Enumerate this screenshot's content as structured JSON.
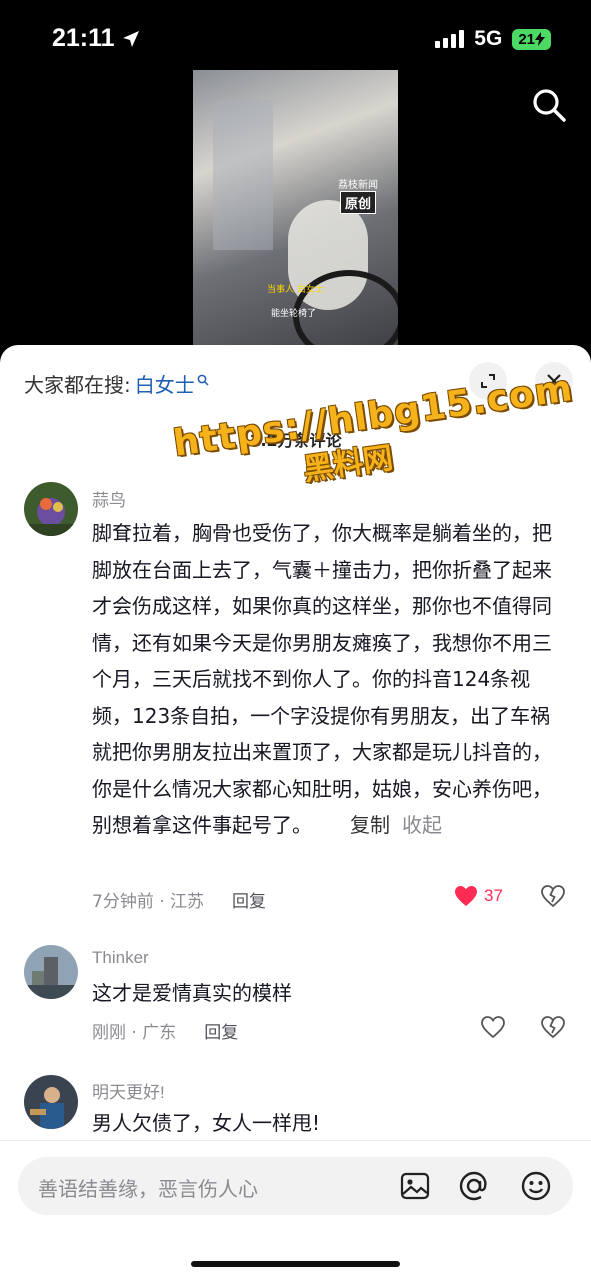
{
  "status": {
    "time": "21:11",
    "network": "5G",
    "battery": "21"
  },
  "video": {
    "watermark_top": "荔枝新闻",
    "watermark_badge": "原创",
    "caption_1": "当事人 白女士",
    "caption_2": "能坐轮椅了"
  },
  "sheet": {
    "trending_prefix": "大家都在搜:",
    "trending_keyword": "白女士",
    "comment_count": "1.2万条评论"
  },
  "watermark": {
    "url": "https://hlbg15.com",
    "site": "黑料网"
  },
  "comments": [
    {
      "name": "蒜鸟",
      "text": "脚耷拉着，胸骨也受伤了，你大概率是躺着坐的，把脚放在台面上去了，气囊＋撞击力，把你折叠了起来才会伤成这样，如果你真的这样坐，那你也不值得同情，还有如果今天是你男朋友瘫痪了，我想你不用三个月，三天后就找不到你人了。你的抖音124条视频，123条自拍，一个字没提你有男朋友，出了车祸就把你男朋友拉出来置顶了，大家都是玩儿抖音的，你是什么情况大家都心知肚明，姑娘，安心养伤吧，别想着拿这件事起号了。",
      "copy_label": "复制",
      "collapse_label": "收起",
      "meta": "7分钟前 · 江苏",
      "reply_label": "回复",
      "likes": "37",
      "liked": true
    },
    {
      "name": "Thinker",
      "text": "这才是爱情真实的模样",
      "meta": "刚刚 · 广东",
      "reply_label": "回复"
    },
    {
      "name": "明天更好!",
      "text": "男人欠债了，女人一样甩!"
    }
  ],
  "input": {
    "placeholder": "善语结善缘，恶言伤人心"
  },
  "icons": {
    "location": "location-arrow-icon",
    "search": "search-icon",
    "expand": "expand-icon",
    "close": "close-icon",
    "like": "heart-icon",
    "dislike": "broken-heart-icon",
    "image": "image-icon",
    "mention": "at-icon",
    "emoji": "emoji-icon"
  },
  "colors": {
    "accent_like": "#fe2c55",
    "keyword": "#1e5fb3",
    "battery": "#4cd964",
    "watermark": "#f6b21a"
  }
}
